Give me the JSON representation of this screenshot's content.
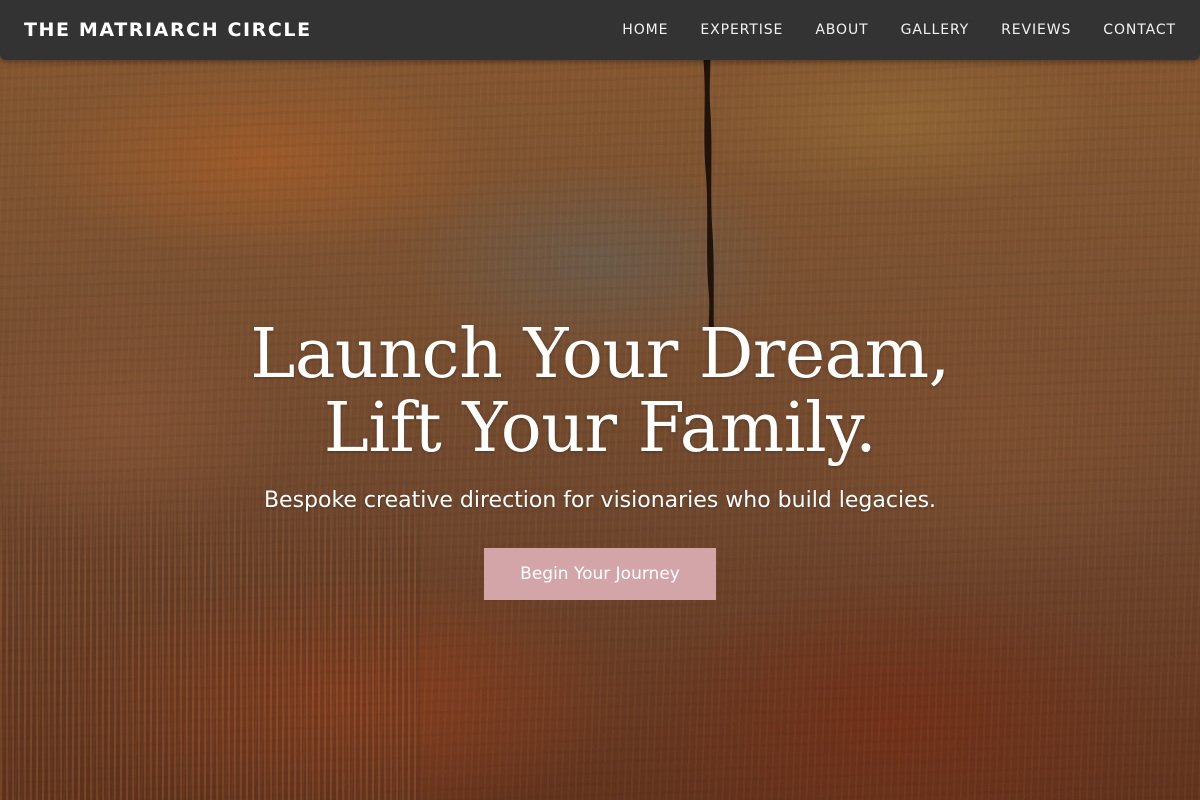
{
  "brand": {
    "name": "THE MATRIARCH CIRCLE"
  },
  "nav": {
    "items": [
      {
        "label": "HOME"
      },
      {
        "label": "EXPERTISE"
      },
      {
        "label": "ABOUT"
      },
      {
        "label": "GALLERY"
      },
      {
        "label": "REVIEWS"
      },
      {
        "label": "CONTACT"
      }
    ]
  },
  "hero": {
    "headline_line1": "Launch Your Dream,",
    "headline_line2": "Lift Your Family.",
    "subtitle": "Bespoke creative direction for visionaries who build legacies.",
    "cta_label": "Begin Your Journey"
  },
  "colors": {
    "navbar_bg": "#333333",
    "cta_bg": "#d4a5a8",
    "text": "#ffffff"
  }
}
